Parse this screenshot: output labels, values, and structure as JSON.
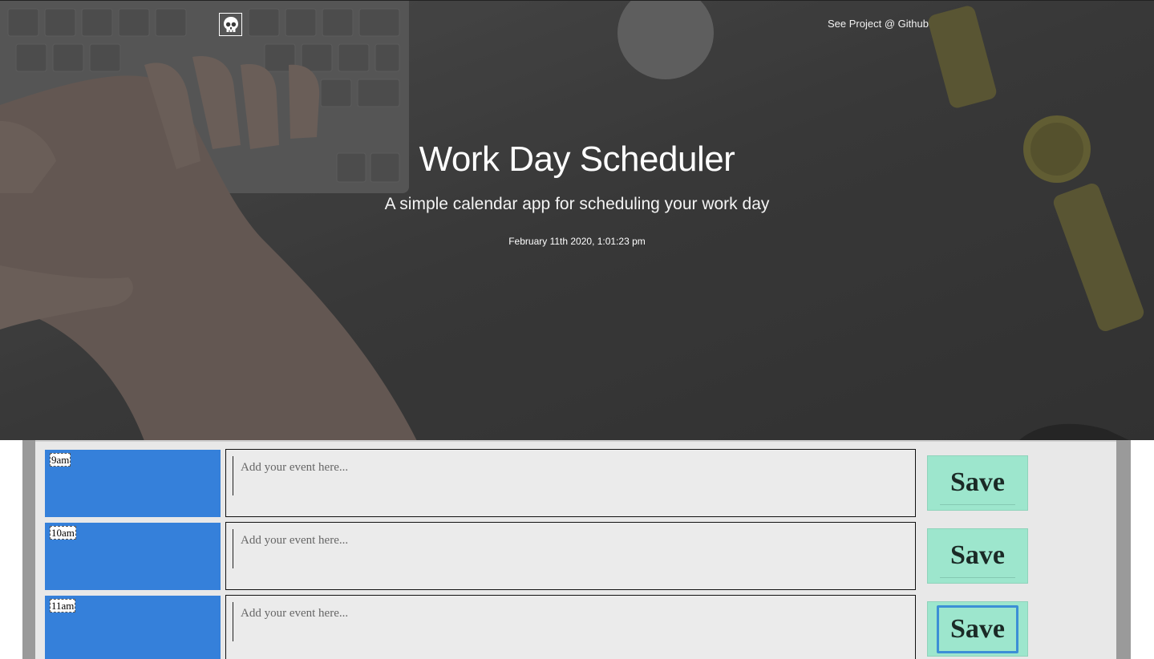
{
  "header": {
    "logo_icon": "skull-icon",
    "nav_link": "See Project @ Github",
    "title": "Work Day Scheduler",
    "subtitle": "A simple calendar app for scheduling your work day",
    "current_datetime": "February 11th 2020, 1:01:23 pm"
  },
  "colors": {
    "hour_block": "#3580da",
    "save_button": "#9de6cd",
    "event_background": "#ebebeb",
    "focus_ring": "#3c8fd6"
  },
  "schedule": {
    "rows": [
      {
        "hour": "9am",
        "event_placeholder": "Add your event here...",
        "event_value": "",
        "save_label": "Save"
      },
      {
        "hour": "10am",
        "event_placeholder": "Add your event here...",
        "event_value": "",
        "save_label": "Save"
      },
      {
        "hour": "11am",
        "event_placeholder": "Add your event here...",
        "event_value": "",
        "save_label": "Save"
      }
    ]
  }
}
